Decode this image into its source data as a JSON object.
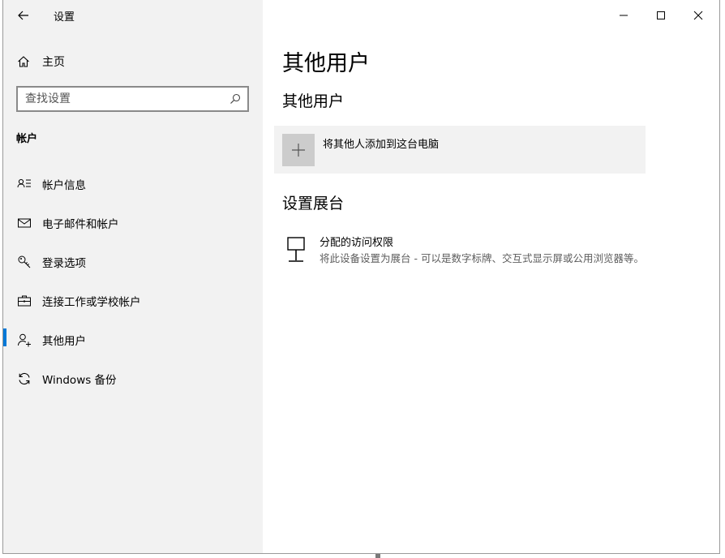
{
  "window": {
    "title": "设置"
  },
  "sidebar": {
    "home_label": "主页",
    "search": {
      "placeholder": "查找设置",
      "value": ""
    },
    "section_title": "帐户",
    "items": [
      {
        "label": "帐户信息",
        "icon": "account-info-icon"
      },
      {
        "label": "电子邮件和帐户",
        "icon": "mail-icon"
      },
      {
        "label": "登录选项",
        "icon": "key-icon"
      },
      {
        "label": "连接工作或学校帐户",
        "icon": "briefcase-icon"
      },
      {
        "label": "其他用户",
        "icon": "add-person-icon",
        "selected": true
      },
      {
        "label": "Windows 备份",
        "icon": "sync-icon"
      }
    ]
  },
  "main": {
    "page_title": "其他用户",
    "other_users": {
      "heading": "其他用户",
      "add_label": "将其他人添加到这台电脑"
    },
    "kiosk": {
      "heading": "设置展台",
      "item_title": "分配的访问权限",
      "item_desc": "将此设备设置为展台 - 可以是数字标牌、交互式显示屏或公用浏览器等。"
    }
  },
  "colors": {
    "accent": "#0078d7",
    "sidebar_bg": "#f2f2f2",
    "row_bg": "#f2f2f2",
    "tile_bg": "#cccccc"
  }
}
